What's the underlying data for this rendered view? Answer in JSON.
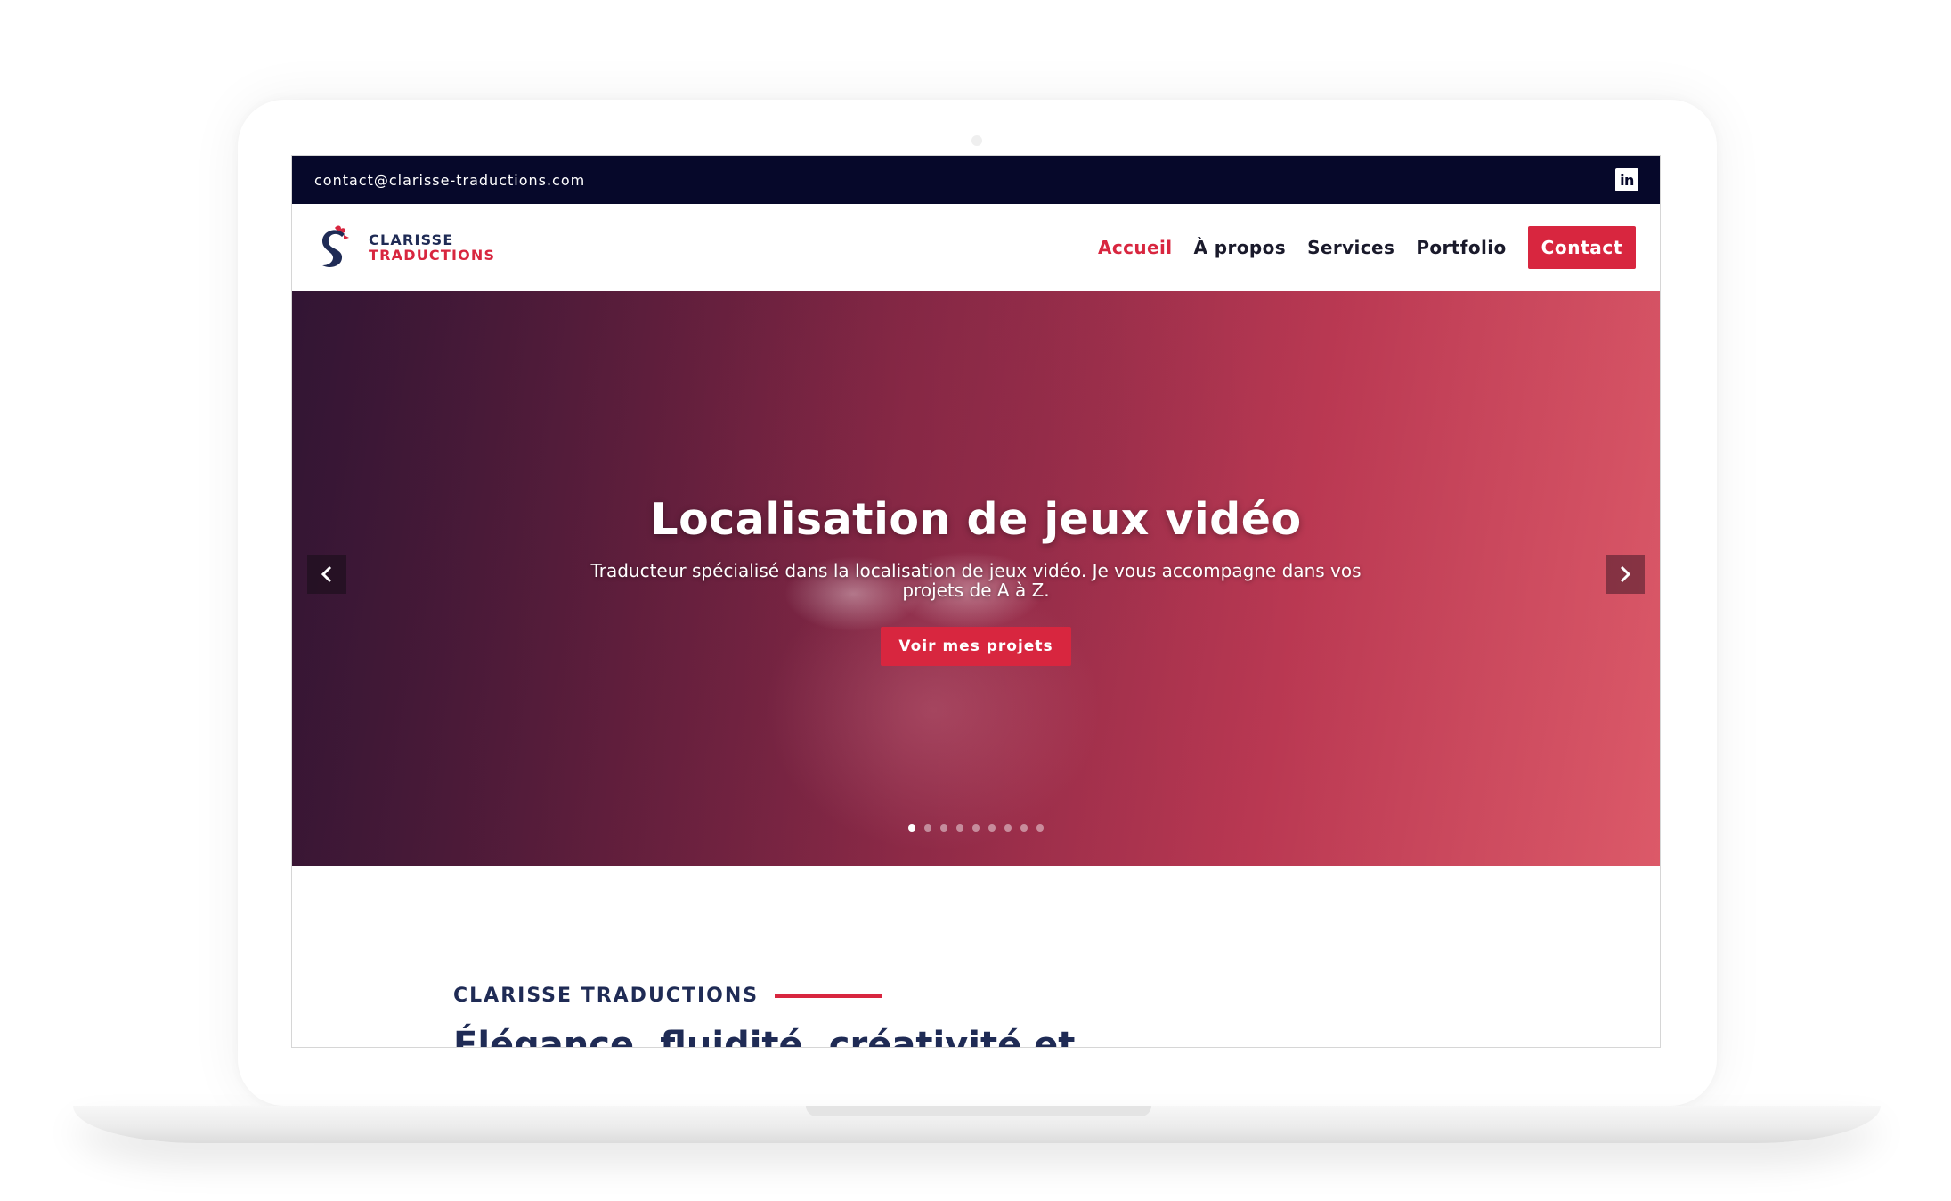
{
  "topbar": {
    "email": "contact@clarisse-traductions.com",
    "social_icon": "linkedin-icon",
    "social_text": "in"
  },
  "header": {
    "logo": {
      "line1": "CLARISSE",
      "line2": "TRADUCTIONS"
    },
    "nav": {
      "home": "Accueil",
      "about": "À propos",
      "services": "Services",
      "portfolio": "Portfolio",
      "contact": "Contact"
    }
  },
  "hero": {
    "title": "Localisation de jeux vidéo",
    "subtitle": "Traducteur spécialisé dans la localisation de jeux vidéo. Je vous accompagne dans vos projets de A à Z.",
    "cta": "Voir mes projets",
    "prev_icon": "chevron-left-icon",
    "next_icon": "chevron-right-icon",
    "slide_count": 9,
    "active_slide": 1
  },
  "about": {
    "kicker": "CLARISSE TRADUCTIONS",
    "heading": "Élégance, fluidité, créativité et"
  },
  "colors": {
    "brand_red": "#d8263f",
    "brand_navy": "#1f2b55",
    "topbar": "#06082a"
  }
}
